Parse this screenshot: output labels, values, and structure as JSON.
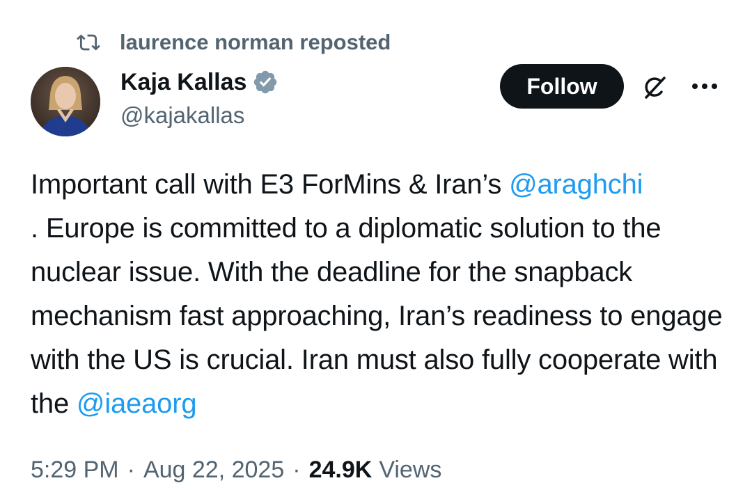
{
  "repost": {
    "text": "laurence norman reposted",
    "icon": "repost-icon"
  },
  "author": {
    "display_name": "Kaja Kallas",
    "handle": "@kajakallas",
    "verified_icon": "verified-badge-icon"
  },
  "actions": {
    "follow_label": "Follow",
    "grok_icon": "grok-icon",
    "more_icon": "more-options-icon"
  },
  "tweet": {
    "line1_text": "Important call with E3 ForMins & Iran’s ",
    "mention1": "@araghchi",
    "line2_text": ". Europe is committed to a diplomatic solution to the nuclear issue. With the deadline for the snapback mechanism fast approaching, Iran’s readiness to engage with the US is crucial. Iran must also fully cooperate with the ",
    "mention2": "@iaeaorg"
  },
  "meta": {
    "time": "5:29 PM",
    "date": "Aug 22, 2025",
    "separator": "·",
    "views_count": "24.9K",
    "views_label": "Views"
  },
  "colors": {
    "text": "#0f1419",
    "secondary": "#536471",
    "link": "#1d9bf0",
    "verified": "#829aab"
  }
}
